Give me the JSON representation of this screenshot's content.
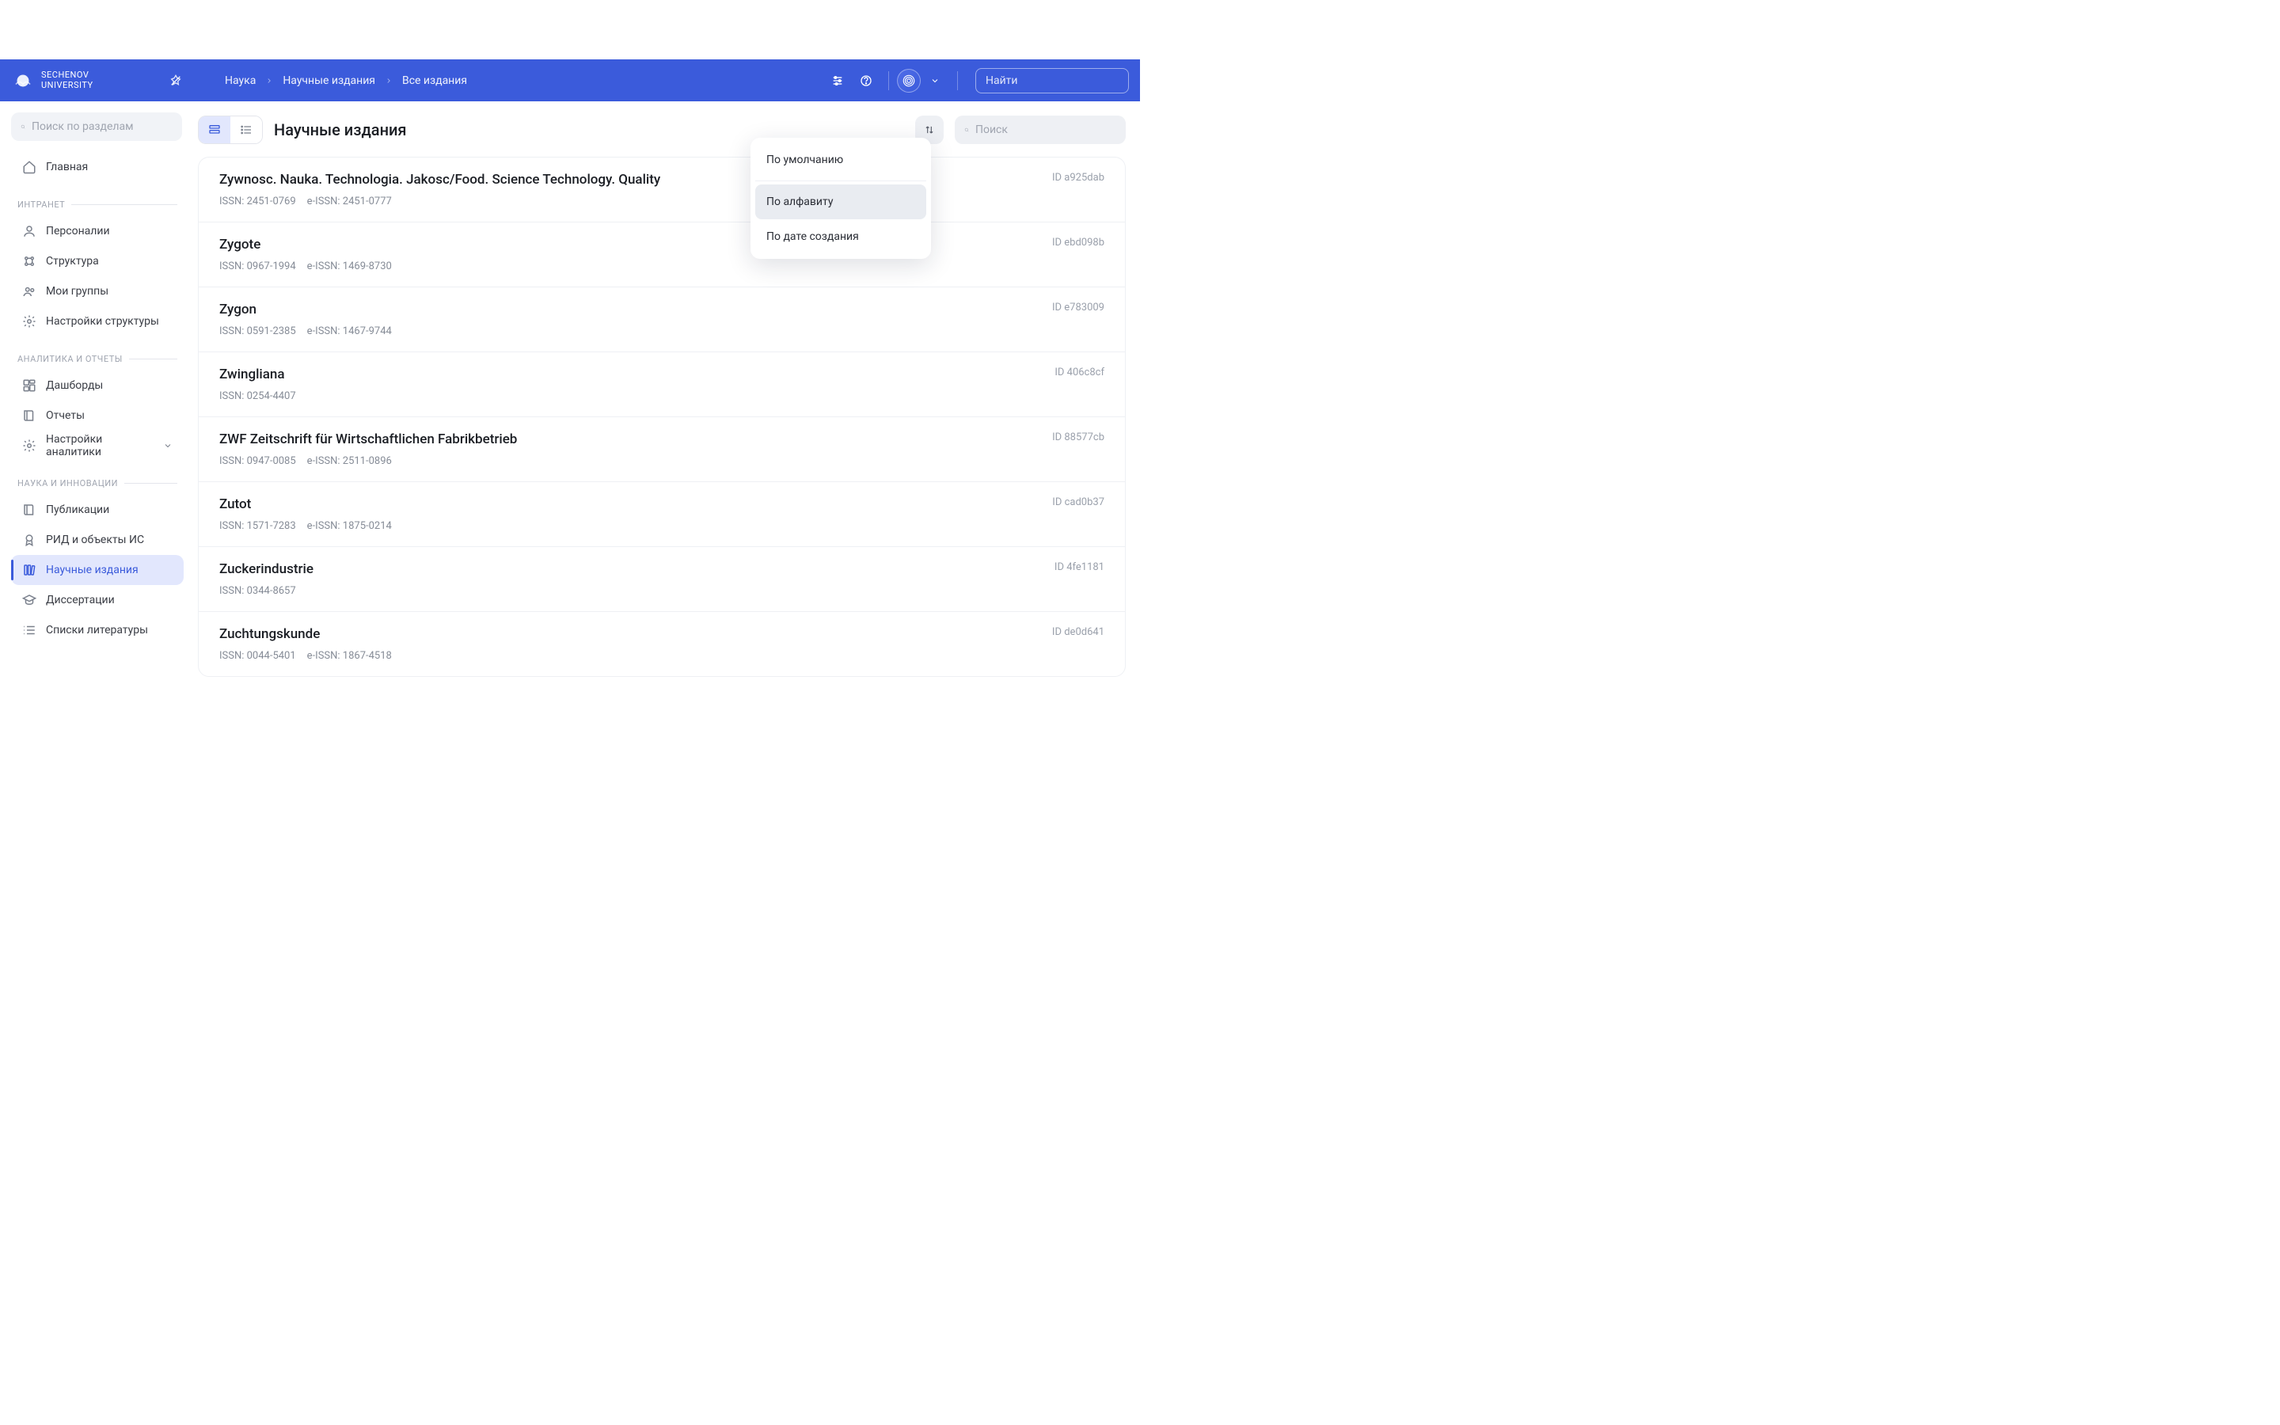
{
  "header": {
    "logo_line1": "SECHENOV",
    "logo_line2": "UNIVERSITY",
    "breadcrumb": [
      "Наука",
      "Научные издания",
      "Все издания"
    ],
    "search_placeholder": "Найти"
  },
  "sidebar": {
    "search_placeholder": "Поиск по разделам",
    "home": "Главная",
    "groups": [
      {
        "title": "ИНТРАНЕТ",
        "items": [
          {
            "label": "Персоналии",
            "icon": "user"
          },
          {
            "label": "Структура",
            "icon": "grid"
          },
          {
            "label": "Мои группы",
            "icon": "groups"
          },
          {
            "label": "Настройки структуры",
            "icon": "gear"
          }
        ]
      },
      {
        "title": "АНАЛИТИКА И ОТЧЕТЫ",
        "items": [
          {
            "label": "Дашборды",
            "icon": "dashboard"
          },
          {
            "label": "Отчеты",
            "icon": "book"
          },
          {
            "label": "Настройки аналитики",
            "icon": "gear",
            "expandable": true
          }
        ]
      },
      {
        "title": "НАУКА И ИННОВАЦИИ",
        "items": [
          {
            "label": "Публикации",
            "icon": "book"
          },
          {
            "label": "РИД и объекты ИС",
            "icon": "badge"
          },
          {
            "label": "Научные издания",
            "icon": "books",
            "active": true
          },
          {
            "label": "Диссертации",
            "icon": "grad"
          },
          {
            "label": "Списки литературы",
            "icon": "list"
          }
        ]
      }
    ]
  },
  "toolbar": {
    "title": "Научные издания",
    "search_placeholder": "Поиск"
  },
  "sort_menu": {
    "open": true,
    "options": [
      "По умолчанию",
      "По алфавиту",
      "По дате создания"
    ],
    "selected": 1
  },
  "rows": [
    {
      "title": "Zywnosc. Nauka. Technologia. Jakosc/Food. Science Technology. Quality",
      "issn": "2451-0769",
      "eissn": "2451-0777",
      "id": "a925dab"
    },
    {
      "title": "Zygote",
      "issn": "0967-1994",
      "eissn": "1469-8730",
      "id": "ebd098b"
    },
    {
      "title": "Zygon",
      "issn": "0591-2385",
      "eissn": "1467-9744",
      "id": "e783009"
    },
    {
      "title": "Zwingliana",
      "issn": "0254-4407",
      "eissn": null,
      "id": "406c8cf"
    },
    {
      "title": "ZWF Zeitschrift für Wirtschaftlichen Fabrikbetrieb",
      "issn": "0947-0085",
      "eissn": "2511-0896",
      "id": "88577cb"
    },
    {
      "title": "Zutot",
      "issn": "1571-7283",
      "eissn": "1875-0214",
      "id": "cad0b37"
    },
    {
      "title": "Zuckerindustrie",
      "issn": "0344-8657",
      "eissn": null,
      "id": "4fe1181"
    },
    {
      "title": "Zuchtungskunde",
      "issn": "0044-5401",
      "eissn": "1867-4518",
      "id": "de0d641"
    }
  ],
  "labels": {
    "issn": "ISSN:",
    "eissn": "e-ISSN:",
    "id": "ID"
  }
}
